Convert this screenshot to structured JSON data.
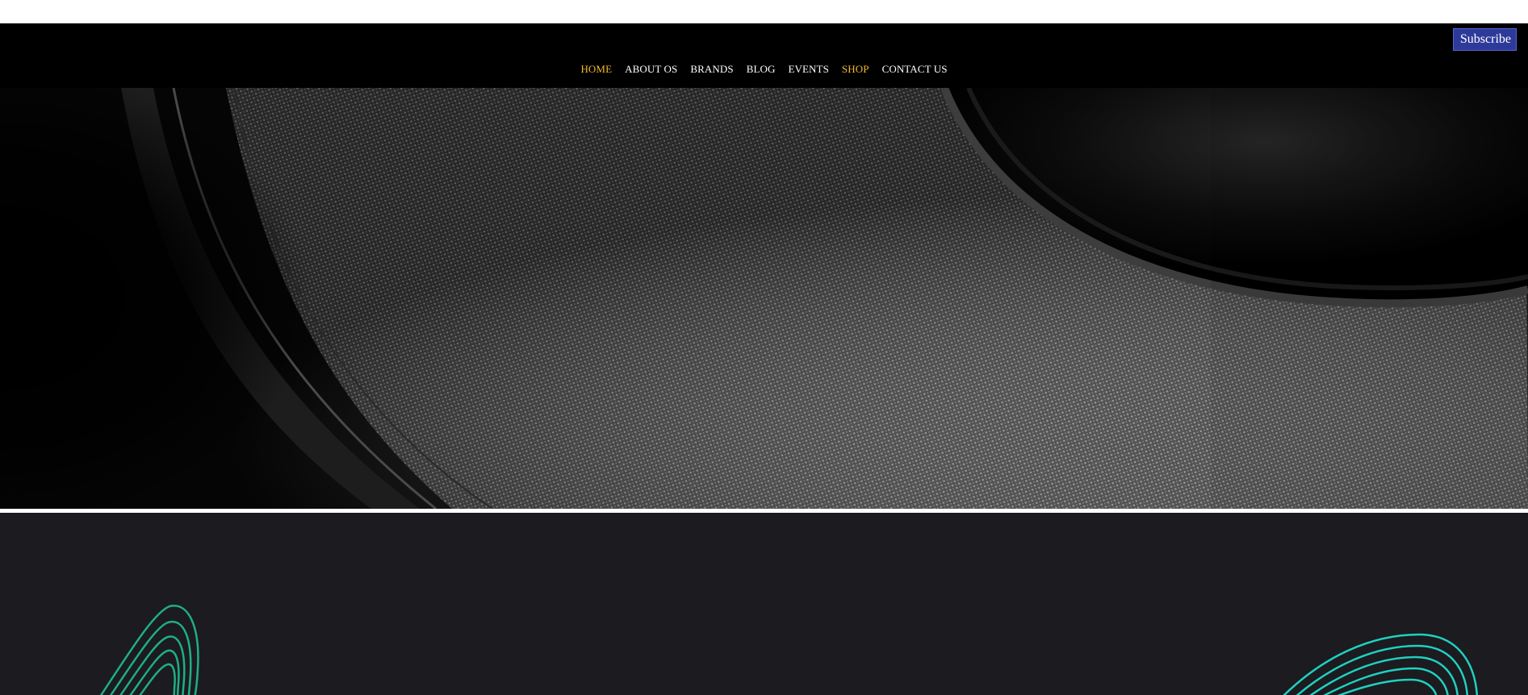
{
  "header": {
    "subscribe_label": "Subscribe",
    "nav": [
      {
        "label": "HOME",
        "active": true
      },
      {
        "label": "ABOUT OS",
        "active": false
      },
      {
        "label": "BRANDS",
        "active": false
      },
      {
        "label": "BLOG",
        "active": false
      },
      {
        "label": "EVENTS",
        "active": false
      },
      {
        "label": "SHOP",
        "active": true
      },
      {
        "label": "CONTACT US",
        "active": false
      }
    ]
  },
  "colors": {
    "accent": "#f5b82e",
    "subscribe_bg": "#2e3a9a",
    "lower_bg": "#1b1b20",
    "wave_left": "#1fae85",
    "wave_right": "#1fd1c0"
  },
  "hero": {
    "image": "speaker-cone-closeup"
  },
  "decor": {
    "left_icon": "wave-lines-icon",
    "right_icon": "wave-lines-icon"
  }
}
